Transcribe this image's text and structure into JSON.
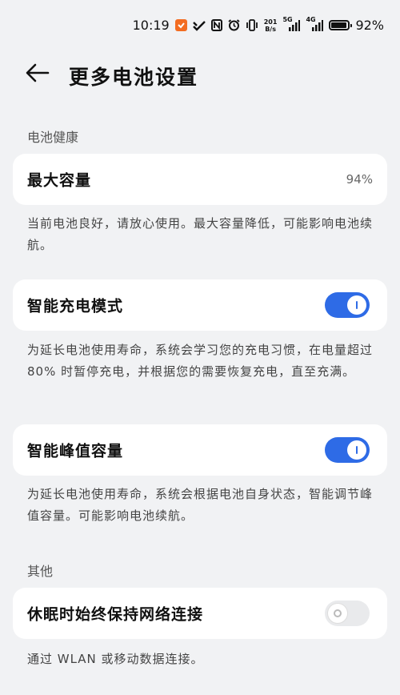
{
  "status_bar": {
    "time": "10:19",
    "net_speed_value": "201",
    "net_speed_unit": "B/s",
    "sig1_tag": "5G",
    "sig2_tag": "4G",
    "battery_percent": "92%",
    "battery_level": 0.92,
    "icons": [
      "taobao-app-icon",
      "check-icon",
      "nfc-icon",
      "alarm-icon",
      "vibrate-icon",
      "signal-icon",
      "signal-icon",
      "battery-icon"
    ]
  },
  "header": {
    "title": "更多电池设置",
    "back_icon": "back-arrow-icon"
  },
  "sections": {
    "battery_health": "电池健康",
    "other": "其他"
  },
  "max_capacity": {
    "label": "最大容量",
    "value": "94%",
    "desc": "当前电池良好，请放心使用。最大容量降低，可能影响电池续航。"
  },
  "smart_charging": {
    "label": "智能充电模式",
    "enabled": true,
    "desc": "为延长电池使用寿命，系统会学习您的充电习惯，在电量超过 80% 时暂停充电，并根据您的需要恢复充电，直至充满。"
  },
  "smart_peak": {
    "label": "智能峰值容量",
    "enabled": true,
    "desc": "为延长电池使用寿命，系统会根据电池自身状态，智能调节峰值容量。可能影响电池续航。"
  },
  "sleep_connection": {
    "label": "休眠时始终保持网络连接",
    "enabled": false,
    "desc": "通过 WLAN 或移动数据连接。"
  },
  "colors": {
    "accent": "#2e6be6",
    "background": "#f1f2f4",
    "card": "#ffffff"
  }
}
